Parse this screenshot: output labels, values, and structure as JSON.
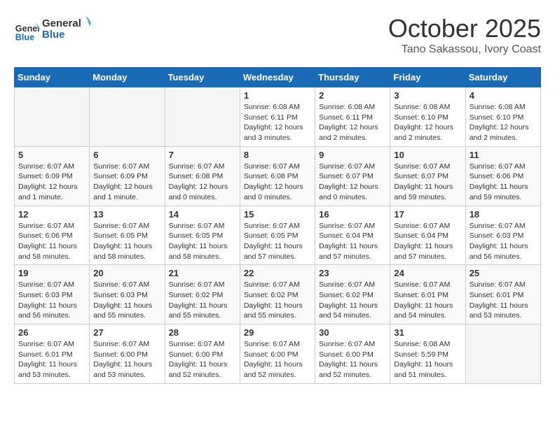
{
  "header": {
    "logo_line1": "General",
    "logo_line2": "Blue",
    "month_title": "October 2025",
    "subtitle": "Tano Sakassou, Ivory Coast"
  },
  "days_of_week": [
    "Sunday",
    "Monday",
    "Tuesday",
    "Wednesday",
    "Thursday",
    "Friday",
    "Saturday"
  ],
  "weeks": [
    [
      {
        "day": "",
        "info": ""
      },
      {
        "day": "",
        "info": ""
      },
      {
        "day": "",
        "info": ""
      },
      {
        "day": "1",
        "info": "Sunrise: 6:08 AM\nSunset: 6:11 PM\nDaylight: 12 hours and 3 minutes."
      },
      {
        "day": "2",
        "info": "Sunrise: 6:08 AM\nSunset: 6:11 PM\nDaylight: 12 hours and 2 minutes."
      },
      {
        "day": "3",
        "info": "Sunrise: 6:08 AM\nSunset: 6:10 PM\nDaylight: 12 hours and 2 minutes."
      },
      {
        "day": "4",
        "info": "Sunrise: 6:08 AM\nSunset: 6:10 PM\nDaylight: 12 hours and 2 minutes."
      }
    ],
    [
      {
        "day": "5",
        "info": "Sunrise: 6:07 AM\nSunset: 6:09 PM\nDaylight: 12 hours and 1 minute."
      },
      {
        "day": "6",
        "info": "Sunrise: 6:07 AM\nSunset: 6:09 PM\nDaylight: 12 hours and 1 minute."
      },
      {
        "day": "7",
        "info": "Sunrise: 6:07 AM\nSunset: 6:08 PM\nDaylight: 12 hours and 0 minutes."
      },
      {
        "day": "8",
        "info": "Sunrise: 6:07 AM\nSunset: 6:08 PM\nDaylight: 12 hours and 0 minutes."
      },
      {
        "day": "9",
        "info": "Sunrise: 6:07 AM\nSunset: 6:07 PM\nDaylight: 12 hours and 0 minutes."
      },
      {
        "day": "10",
        "info": "Sunrise: 6:07 AM\nSunset: 6:07 PM\nDaylight: 11 hours and 59 minutes."
      },
      {
        "day": "11",
        "info": "Sunrise: 6:07 AM\nSunset: 6:06 PM\nDaylight: 11 hours and 59 minutes."
      }
    ],
    [
      {
        "day": "12",
        "info": "Sunrise: 6:07 AM\nSunset: 6:06 PM\nDaylight: 11 hours and 58 minutes."
      },
      {
        "day": "13",
        "info": "Sunrise: 6:07 AM\nSunset: 6:05 PM\nDaylight: 11 hours and 58 minutes."
      },
      {
        "day": "14",
        "info": "Sunrise: 6:07 AM\nSunset: 6:05 PM\nDaylight: 11 hours and 58 minutes."
      },
      {
        "day": "15",
        "info": "Sunrise: 6:07 AM\nSunset: 6:05 PM\nDaylight: 11 hours and 57 minutes."
      },
      {
        "day": "16",
        "info": "Sunrise: 6:07 AM\nSunset: 6:04 PM\nDaylight: 11 hours and 57 minutes."
      },
      {
        "day": "17",
        "info": "Sunrise: 6:07 AM\nSunset: 6:04 PM\nDaylight: 11 hours and 57 minutes."
      },
      {
        "day": "18",
        "info": "Sunrise: 6:07 AM\nSunset: 6:03 PM\nDaylight: 11 hours and 56 minutes."
      }
    ],
    [
      {
        "day": "19",
        "info": "Sunrise: 6:07 AM\nSunset: 6:03 PM\nDaylight: 11 hours and 56 minutes."
      },
      {
        "day": "20",
        "info": "Sunrise: 6:07 AM\nSunset: 6:03 PM\nDaylight: 11 hours and 55 minutes."
      },
      {
        "day": "21",
        "info": "Sunrise: 6:07 AM\nSunset: 6:02 PM\nDaylight: 11 hours and 55 minutes."
      },
      {
        "day": "22",
        "info": "Sunrise: 6:07 AM\nSunset: 6:02 PM\nDaylight: 11 hours and 55 minutes."
      },
      {
        "day": "23",
        "info": "Sunrise: 6:07 AM\nSunset: 6:02 PM\nDaylight: 11 hours and 54 minutes."
      },
      {
        "day": "24",
        "info": "Sunrise: 6:07 AM\nSunset: 6:01 PM\nDaylight: 11 hours and 54 minutes."
      },
      {
        "day": "25",
        "info": "Sunrise: 6:07 AM\nSunset: 6:01 PM\nDaylight: 11 hours and 53 minutes."
      }
    ],
    [
      {
        "day": "26",
        "info": "Sunrise: 6:07 AM\nSunset: 6:01 PM\nDaylight: 11 hours and 53 minutes."
      },
      {
        "day": "27",
        "info": "Sunrise: 6:07 AM\nSunset: 6:00 PM\nDaylight: 11 hours and 53 minutes."
      },
      {
        "day": "28",
        "info": "Sunrise: 6:07 AM\nSunset: 6:00 PM\nDaylight: 11 hours and 52 minutes."
      },
      {
        "day": "29",
        "info": "Sunrise: 6:07 AM\nSunset: 6:00 PM\nDaylight: 11 hours and 52 minutes."
      },
      {
        "day": "30",
        "info": "Sunrise: 6:07 AM\nSunset: 6:00 PM\nDaylight: 11 hours and 52 minutes."
      },
      {
        "day": "31",
        "info": "Sunrise: 6:08 AM\nSunset: 5:59 PM\nDaylight: 11 hours and 51 minutes."
      },
      {
        "day": "",
        "info": ""
      }
    ]
  ]
}
